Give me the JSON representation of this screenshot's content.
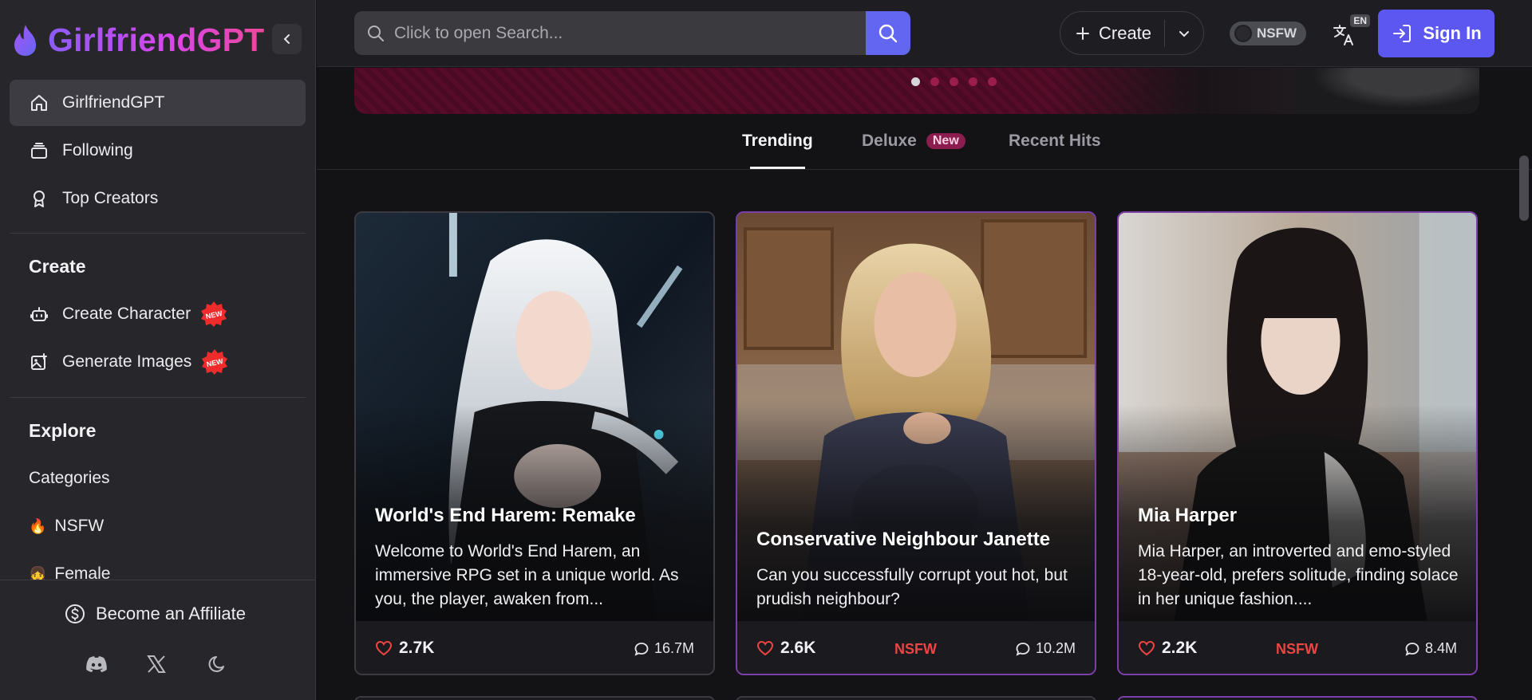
{
  "brand": {
    "name": "GirlfriendGPT"
  },
  "sidebar": {
    "nav": [
      {
        "label": "GirlfriendGPT",
        "icon": "home-icon"
      },
      {
        "label": "Following",
        "icon": "stack-icon"
      },
      {
        "label": "Top Creators",
        "icon": "award-icon"
      }
    ],
    "create_title": "Create",
    "create_items": [
      {
        "label": "Create Character",
        "icon": "bot-icon",
        "badge": "NEW"
      },
      {
        "label": "Generate Images",
        "icon": "image-plus-icon",
        "badge": "NEW"
      }
    ],
    "explore_title": "Explore",
    "explore_items": [
      {
        "label": "Categories"
      },
      {
        "label": "NSFW",
        "emoji": "🔥"
      },
      {
        "label": "Female",
        "emoji": "👧"
      }
    ],
    "footer": {
      "affiliate": "Become an Affiliate"
    }
  },
  "topbar": {
    "search_placeholder": "Click to open Search...",
    "create_label": "Create",
    "nsfw_label": "NSFW",
    "lang_code": "EN",
    "signin_label": "Sign In"
  },
  "tabs": [
    {
      "label": "Trending",
      "active": true
    },
    {
      "label": "Deluxe",
      "tag": "New"
    },
    {
      "label": "Recent Hits"
    }
  ],
  "cards": [
    {
      "title": "World's End Harem: Remake",
      "description": "Welcome to World's End Harem, an immersive RPG set in a unique world. As you, the player, awaken from...",
      "likes": "2.7K",
      "messages": "16.7M",
      "nsfw": ""
    },
    {
      "title": "Conservative Neighbour Janette",
      "description": "Can you successfully corrupt yout hot, but prudish neighbour?",
      "likes": "2.6K",
      "messages": "10.2M",
      "nsfw": "NSFW"
    },
    {
      "title": "Mia Harper",
      "description": "Mia Harper, an introverted and emo-styled 18-year-old, prefers solitude, finding solace in her unique fashion....",
      "likes": "2.2K",
      "messages": "8.4M",
      "nsfw": "NSFW"
    }
  ],
  "colors": {
    "accent": "#5b57f0",
    "brand_gradient_start": "#8b5cf6",
    "brand_gradient_end": "#ec4899",
    "nsfw_red": "#ef4444"
  }
}
